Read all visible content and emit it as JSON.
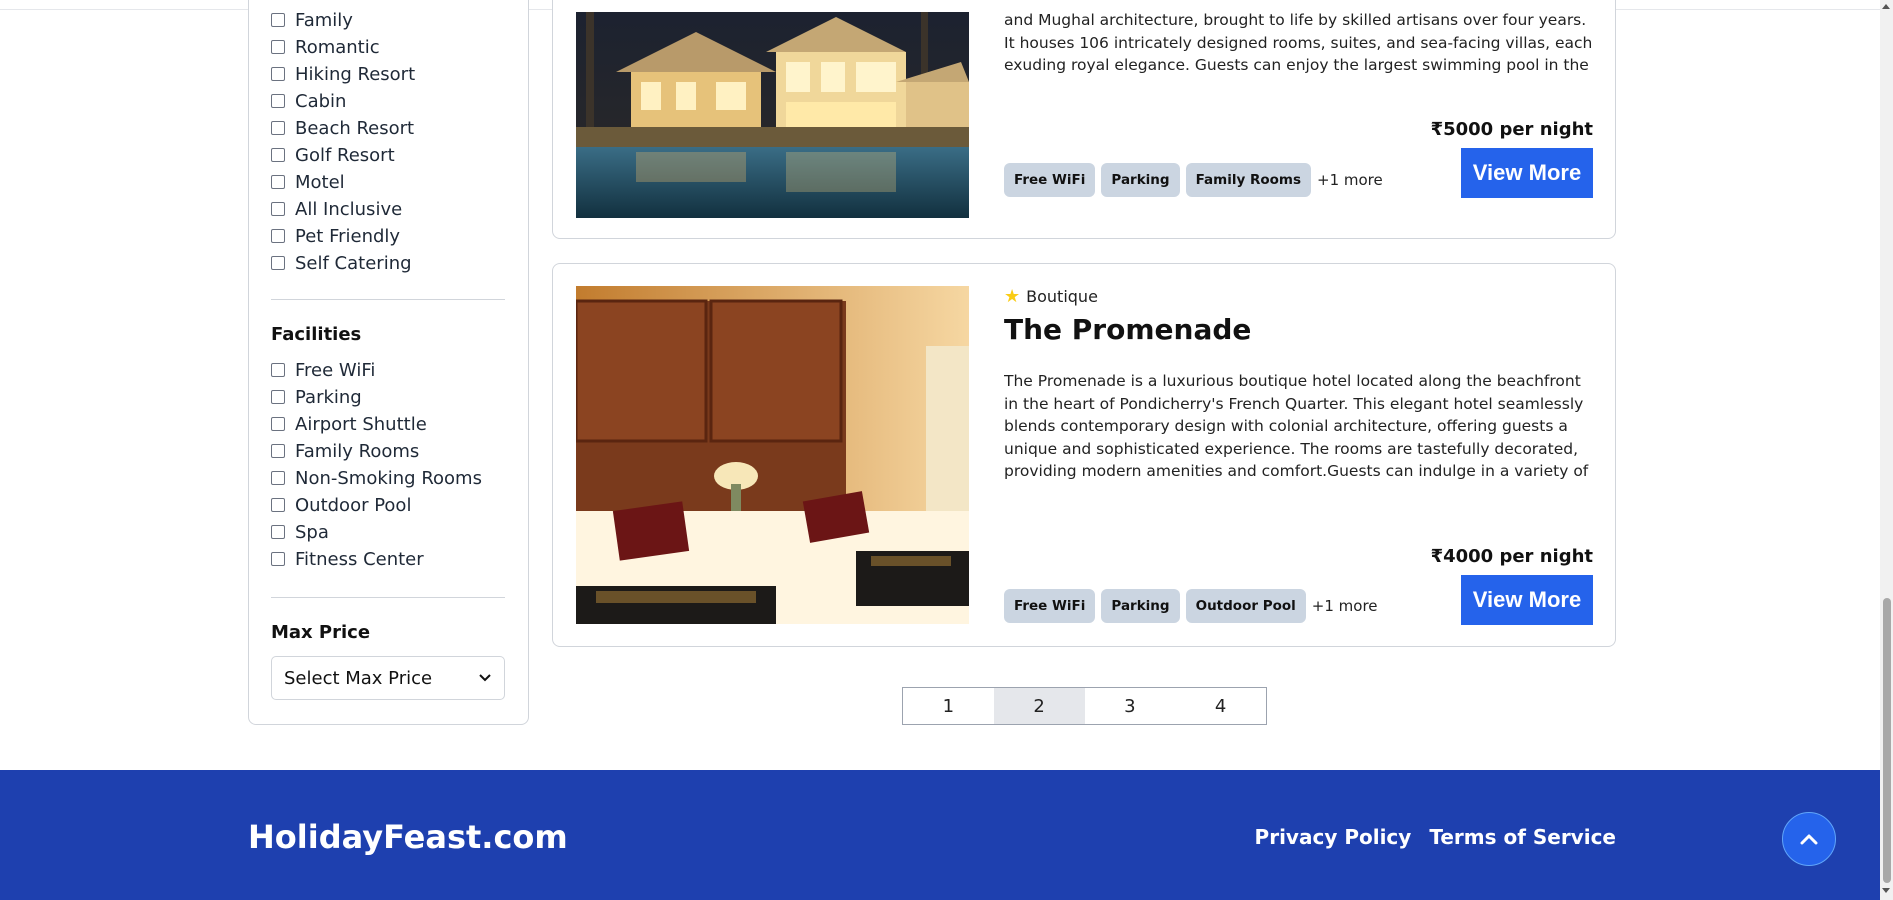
{
  "filters": {
    "types": [
      "Family",
      "Romantic",
      "Hiking Resort",
      "Cabin",
      "Beach Resort",
      "Golf Resort",
      "Motel",
      "All Inclusive",
      "Pet Friendly",
      "Self Catering"
    ],
    "facilities_heading": "Facilities",
    "facilities": [
      "Free WiFi",
      "Parking",
      "Airport Shuttle",
      "Family Rooms",
      "Non-Smoking Rooms",
      "Outdoor Pool",
      "Spa",
      "Fitness Center"
    ],
    "max_price_heading": "Max Price",
    "max_price_selected": "Select Max Price"
  },
  "hotels": [
    {
      "description": "and Mughal architecture, brought to life by skilled artisans over four years. It houses 106 intricately designed rooms, suites, and sea-facing villas, each exuding royal elegance. Guests can enjoy the largest swimming pool in the region, expansive law...",
      "price": "₹5000 per night",
      "button": "View More",
      "tags": [
        "Free WiFi",
        "Parking",
        "Family Rooms"
      ],
      "more": "+1 more"
    },
    {
      "category": "Boutique",
      "name": "The Promenade",
      "description": "The Promenade is a luxurious boutique hotel located along the beachfront in the heart of Pondicherry's French Quarter. This elegant hotel seamlessly blends contemporary design with colonial architecture, offering guests a unique and sophisticated experience. The rooms are tastefully decorated, providing modern amenities and comfort.Guests can indulge in a variety of dining options, including...",
      "price": "₹4000 per night",
      "button": "View More",
      "tags": [
        "Free WiFi",
        "Parking",
        "Outdoor Pool"
      ],
      "more": "+1 more"
    }
  ],
  "pagination": {
    "pages": [
      "1",
      "2",
      "3",
      "4"
    ],
    "active": "2"
  },
  "footer": {
    "brand": "HolidayFeast.com",
    "links": [
      "Privacy Policy",
      "Terms of Service"
    ]
  },
  "colors": {
    "accent": "#2563eb",
    "footer_bg": "#1e40af",
    "tag_bg": "#cbd5e1",
    "star": "#facc15"
  }
}
